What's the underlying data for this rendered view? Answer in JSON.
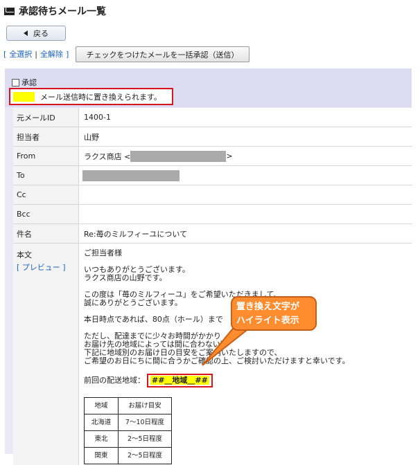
{
  "page": {
    "title": "承認待ちメール一覧"
  },
  "toolbar": {
    "back_label": "戻る",
    "select_all": "全選択",
    "deselect_all": "全解除",
    "bracket_open": "[",
    "bracket_close": "]",
    "separator": "|",
    "bulk_approve_label": "チェックをつけたメールを一括承認（送信）"
  },
  "panel": {
    "approve_label": "承認",
    "legend_text": "メール送信時に置き換えられます。"
  },
  "fields": {
    "source_id": {
      "label": "元メールID",
      "value": "1400-1"
    },
    "assignee": {
      "label": "担当者",
      "value": "山野"
    },
    "from": {
      "label": "From",
      "value_prefix": "ラクス商店 <",
      "value_suffix": ">"
    },
    "to": {
      "label": "To"
    },
    "cc": {
      "label": "Cc"
    },
    "bcc": {
      "label": "Bcc"
    },
    "subject": {
      "label": "件名",
      "value": "Re:苺のミルフィーユについて"
    },
    "body": {
      "label": "本文",
      "preview_link": "[ プレビュー ]"
    }
  },
  "body_text": {
    "greeting": "ご担当者様",
    "p1": "いつもありがとうございます。\nラクス商店の山野です。",
    "p2": "この度は「苺のミルフィーユ」をご希望いただきまして、\n誠にありがとうございます。",
    "p3": "本日時点であれば、80点（ホール）まで",
    "p4": "ただし、配達までに少々お時間がかかり\nお届け先の地域によっては間に合わない可\n下記に地域別のお届け日の目安をご案内いたしますので、\nご希望のお日にちに間に合うかご確認の上、ご検討いただけますと幸いです。",
    "region_prefix": "前回の配送地域：",
    "region_placeholder": "##__地域__##"
  },
  "area_table": {
    "headers": [
      "地域",
      "お届け目安"
    ],
    "rows": [
      [
        "北海道",
        "7〜10日程度"
      ],
      [
        "東北",
        "2〜5日程度"
      ],
      [
        "関東",
        "2〜5日程度"
      ]
    ]
  },
  "callout": {
    "line1": "置き換え文字が",
    "line2": "ハイライト表示"
  },
  "colors": {
    "highlight": "#ffff00",
    "emphasis_border": "#d8141d",
    "callout": "#ff8c2e",
    "link": "#1a62c0"
  },
  "icons": {
    "title": "mail-icon",
    "back": "triangle-left-icon"
  }
}
